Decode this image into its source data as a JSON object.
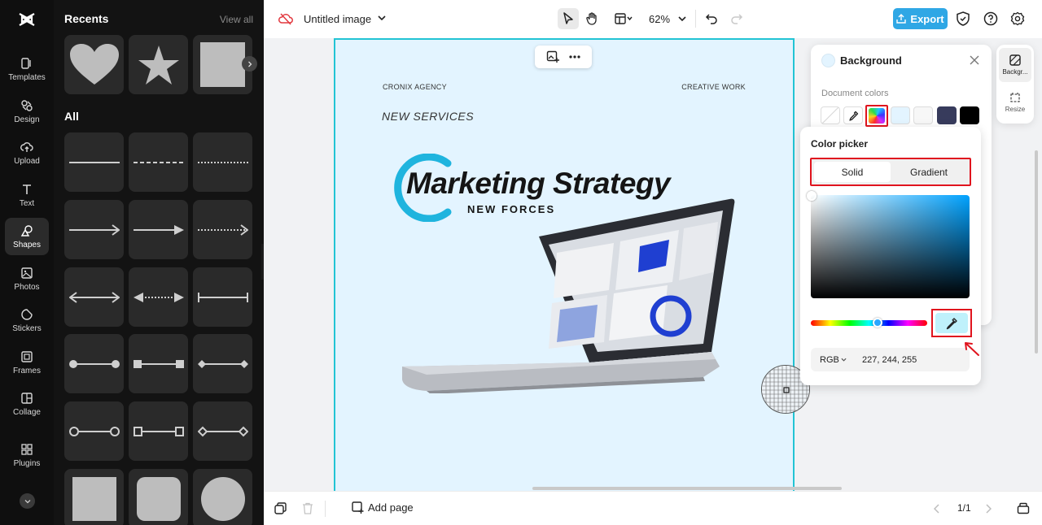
{
  "rail": {
    "items": [
      {
        "label": "Templates",
        "icon": "templates-icon"
      },
      {
        "label": "Design",
        "icon": "design-icon"
      },
      {
        "label": "Upload",
        "icon": "upload-icon"
      },
      {
        "label": "Text",
        "icon": "text-icon"
      },
      {
        "label": "Shapes",
        "icon": "shapes-icon",
        "active": true
      },
      {
        "label": "Photos",
        "icon": "photos-icon"
      },
      {
        "label": "Stickers",
        "icon": "stickers-icon"
      },
      {
        "label": "Frames",
        "icon": "frames-icon"
      },
      {
        "label": "Collage",
        "icon": "collage-icon"
      },
      {
        "label": "Plugins",
        "icon": "plugins-icon"
      }
    ]
  },
  "panel": {
    "recents_title": "Recents",
    "view_all": "View all",
    "all_title": "All"
  },
  "topbar": {
    "doc_title": "Untitled image",
    "zoom": "62%",
    "export_label": "Export",
    "accent": "#2fa7e5"
  },
  "canvas": {
    "agency": "CRONIX AGENCY",
    "creative": "CREATIVE WORK",
    "services": "NEW SERVICES",
    "title": "Marketing Strategy",
    "subtitle": "NEW FORCES",
    "background": "#e3f4ff"
  },
  "bottombar": {
    "add_page": "Add page",
    "pager": "1/1"
  },
  "background_panel": {
    "title": "Background",
    "document_colors": "Document colors",
    "swatches": [
      "#ffffff",
      "eyedropper",
      "rainbow",
      "#e3f4ff",
      "#f7f7f7",
      "#373b5c",
      "#000000"
    ]
  },
  "side_tabs": {
    "background": "Backgr...",
    "resize": "Resize"
  },
  "color_picker": {
    "title": "Color picker",
    "tab_solid": "Solid",
    "tab_gradient": "Gradient",
    "mode": "RGB",
    "rgb_value": "227, 244, 255"
  }
}
